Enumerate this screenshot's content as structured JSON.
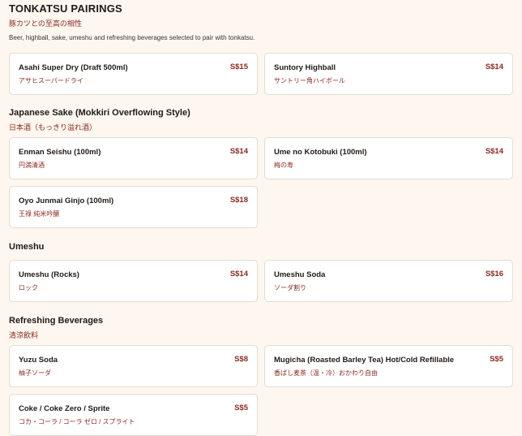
{
  "header": {
    "title": "TONKATSU PAIRINGS",
    "subtitle_jp": "豚カツとの至高の相性",
    "description": "Beer, highball, sake, umeshu and refreshing beverages selected to pair with tonkatsu."
  },
  "sections": [
    {
      "items": [
        {
          "name": "Asahi Super Dry (Draft 500ml)",
          "jp": "アサヒスーパードライ",
          "price": "S$15"
        },
        {
          "name": "Suntory Highball",
          "jp": "サントリー角ハイボール",
          "price": "S$14"
        }
      ]
    },
    {
      "title": "Japanese Sake (Mokkiri Overflowing Style)",
      "subtitle_jp": "日本酒（もっきり溢れ酒）",
      "items": [
        {
          "name": "Enman Seishu (100ml)",
          "jp": "円満清酒",
          "price": "S$14"
        },
        {
          "name": "Ume no Kotobuki (100ml)",
          "jp": "梅の寿",
          "price": "S$14"
        },
        {
          "name": "Oyo Junmai Ginjo (100ml)",
          "jp": "王祿 純米吟醸",
          "price": "S$18"
        }
      ]
    },
    {
      "title": "Umeshu",
      "items": [
        {
          "name": "Umeshu (Rocks)",
          "jp": "ロック",
          "price": "S$14"
        },
        {
          "name": "Umeshu Soda",
          "jp": "ソーダ割り",
          "price": "S$16"
        }
      ]
    },
    {
      "title": "Refreshing Beverages",
      "subtitle_jp": "清涼飲料",
      "items": [
        {
          "name": "Yuzu Soda",
          "jp": "柚子ソーダ",
          "price": "S$8"
        },
        {
          "name": "Mugicha (Roasted Barley Tea) Hot/Cold Refillable",
          "jp": "香ばし麦茶（温・冷）おかわり自由",
          "price": "S$5"
        },
        {
          "name": "Coke / Coke Zero / Sprite",
          "jp": "コカ・コーラ / コーラ ゼロ / スプライト",
          "price": "S$5"
        }
      ]
    }
  ],
  "colors": {
    "accent": "#8b2a22",
    "background": "#fdf7ef",
    "card": "#ffffff"
  }
}
